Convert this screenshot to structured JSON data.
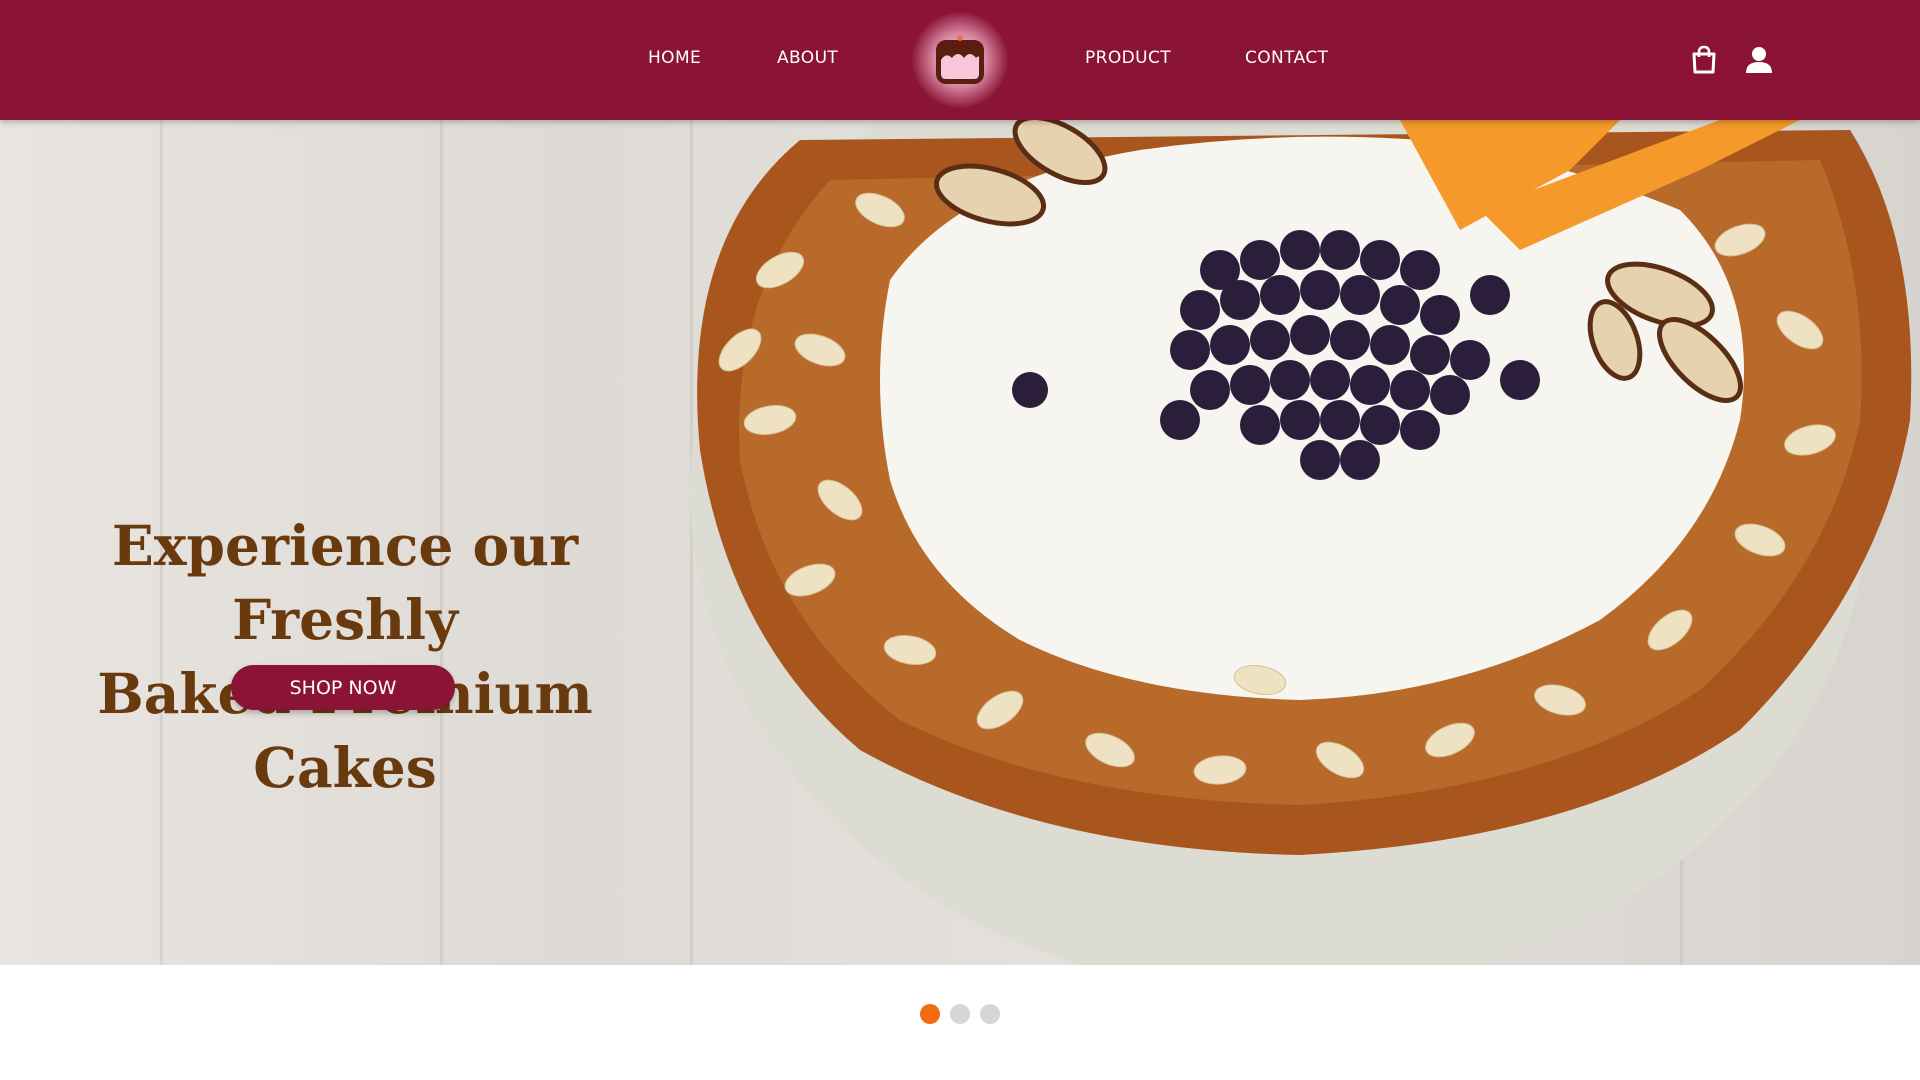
{
  "nav": {
    "home": "HOME",
    "about": "ABOUT",
    "product": "PRODUCT",
    "contact": "CONTACT"
  },
  "icons": {
    "logo": "cake-logo-icon",
    "cart": "shopping-bag-icon",
    "account": "user-icon"
  },
  "hero": {
    "title_line1": "Experience our Freshly",
    "title_line2": "Baked Premium Cakes",
    "cta_label": "SHOP NOW",
    "image": "cake-with-blueberries-cream-almonds"
  },
  "carousel": {
    "slides": 3,
    "active_index": 0
  },
  "colors": {
    "brand": "#8b1436",
    "title_text": "#6a3a0f",
    "active_dot": "#f36c14",
    "inactive_dot": "#d6d6d6"
  }
}
